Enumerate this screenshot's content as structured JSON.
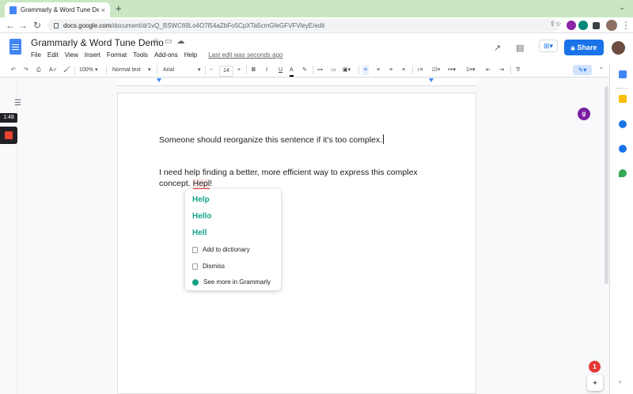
{
  "browser": {
    "tab_title": "Grammarly & Word Tune Demo",
    "tab_close": "×",
    "new_tab": "+",
    "url_host": "docs.google.com",
    "url_path": "/document/d/1vQ_BSWC69Lo4O7l54aZbFo5CpXTa5cmGfeGFVFVleyE/edit"
  },
  "docs": {
    "title": "Grammarly & Word Tune Demo",
    "menu": [
      "File",
      "Edit",
      "View",
      "Insert",
      "Format",
      "Tools",
      "Add-ons",
      "Help"
    ],
    "last_edit": "Last edit was seconds ago",
    "share_label": "Share"
  },
  "toolbar": {
    "zoom": "100%",
    "style": "Normal text",
    "font": "Arial",
    "font_size": "14",
    "minus": "−",
    "plus": "+",
    "bold": "B",
    "italic": "I",
    "underline": "U",
    "text_color": "A"
  },
  "left_rail": {
    "timer": "1:48"
  },
  "document": {
    "line1": "Someone should reorganize this sentence if it's too complex.",
    "line2": "I need help finding a better, more efficient way to express this complex",
    "line3_before": "concept. ",
    "line3_misspelled": "Hepl",
    "line3_after": "!"
  },
  "grammarly_popup": {
    "suggestions": [
      "Help",
      "Hello",
      "Hell"
    ],
    "add_to_dictionary": "Add to dictionary",
    "dismiss": "Dismiss",
    "see_more": "See more in Grammarly"
  },
  "notifications": {
    "badge_count": "1"
  },
  "colors": {
    "accent": "#1a73e8",
    "grammarly_green": "#15a386",
    "error_red": "#e53935",
    "tab_strip": "#c9e7c2"
  }
}
